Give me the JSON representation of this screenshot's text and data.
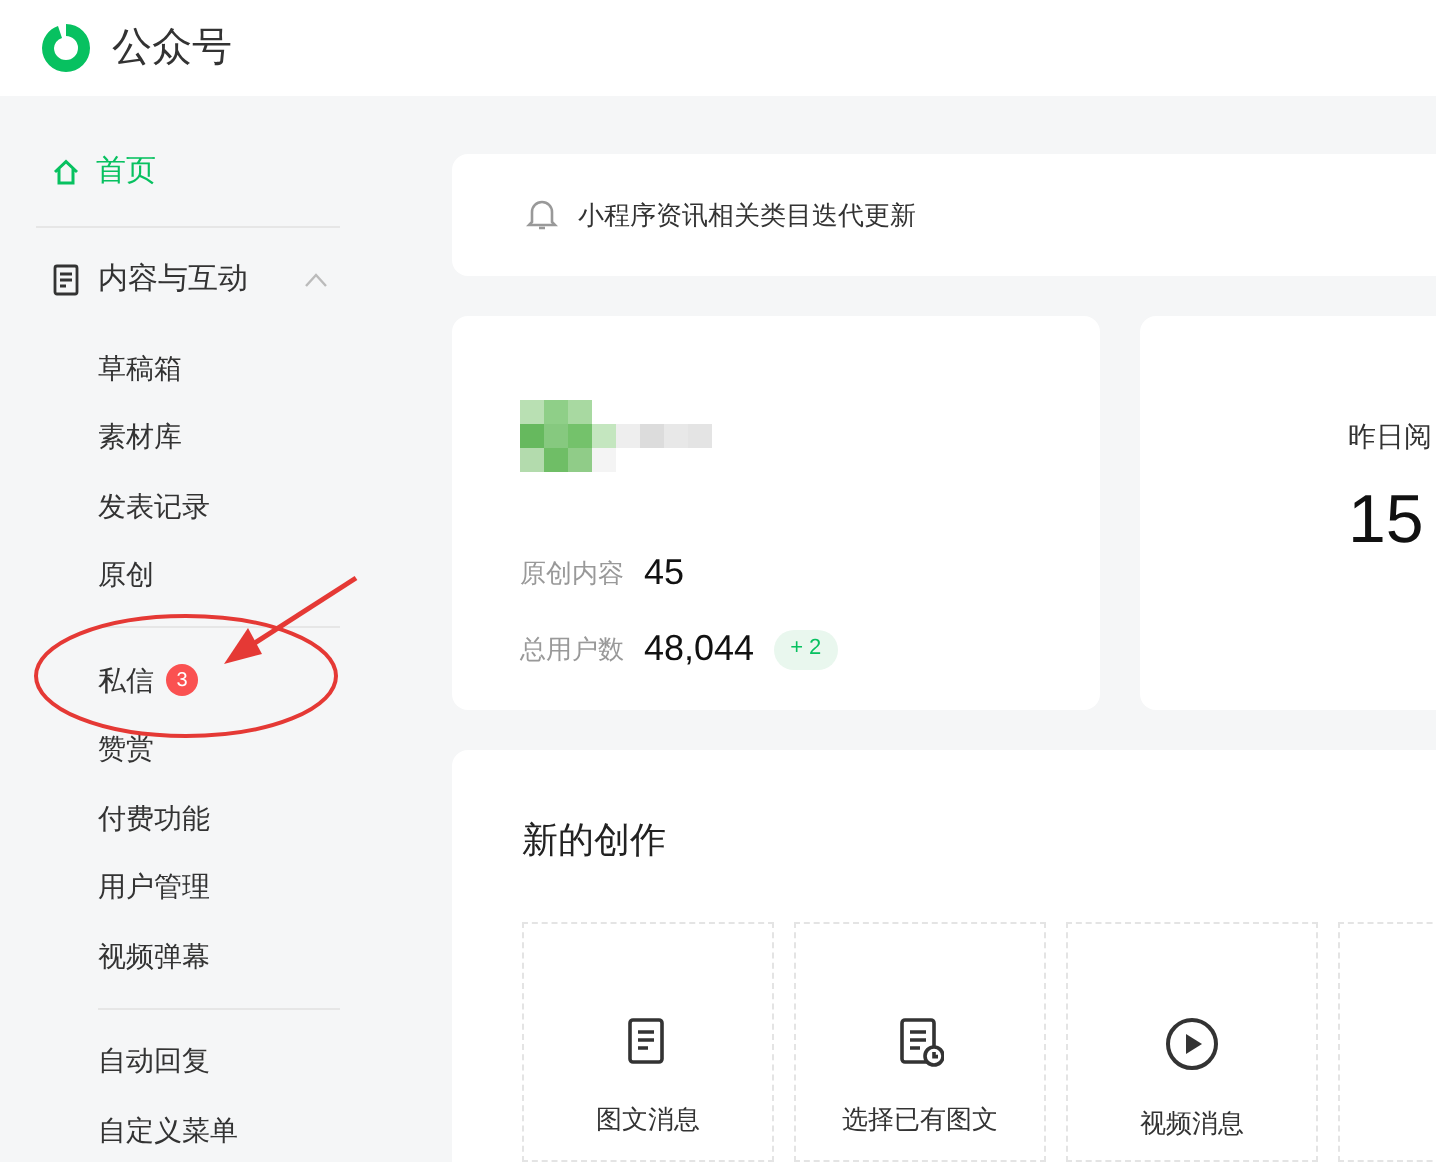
{
  "header": {
    "title": "公众号"
  },
  "sidebar": {
    "home": {
      "label": "首页",
      "selected": true
    },
    "group": {
      "label": "内容与互动",
      "expanded": true,
      "sections": [
        [
          {
            "label": "草稿箱",
            "selected": false
          },
          {
            "label": "素材库",
            "selected": false
          },
          {
            "label": "发表记录",
            "selected": false
          },
          {
            "label": "原创",
            "selected": false
          }
        ],
        [
          {
            "label": "私信",
            "selected": false,
            "badge": "3"
          },
          {
            "label": "赞赏",
            "selected": false
          },
          {
            "label": "付费功能",
            "selected": false
          },
          {
            "label": "用户管理",
            "selected": false
          },
          {
            "label": "视频弹幕",
            "selected": false
          }
        ],
        [
          {
            "label": "自动回复",
            "selected": false
          },
          {
            "label": "自定义菜单",
            "selected": false
          }
        ]
      ]
    }
  },
  "notice": {
    "text": "小程序资讯相关类目迭代更新"
  },
  "account": {
    "stats": [
      {
        "label": "原创内容",
        "value": "45"
      },
      {
        "label": "总用户数",
        "value": "48,044",
        "delta": "+ 2"
      }
    ]
  },
  "reading": {
    "label": "昨日阅",
    "value": "15"
  },
  "creation": {
    "title": "新的创作",
    "items": [
      {
        "kind": "article",
        "label": "图文消息"
      },
      {
        "kind": "history",
        "label": "选择已有图文"
      },
      {
        "kind": "video",
        "label": "视频消息"
      }
    ]
  }
}
